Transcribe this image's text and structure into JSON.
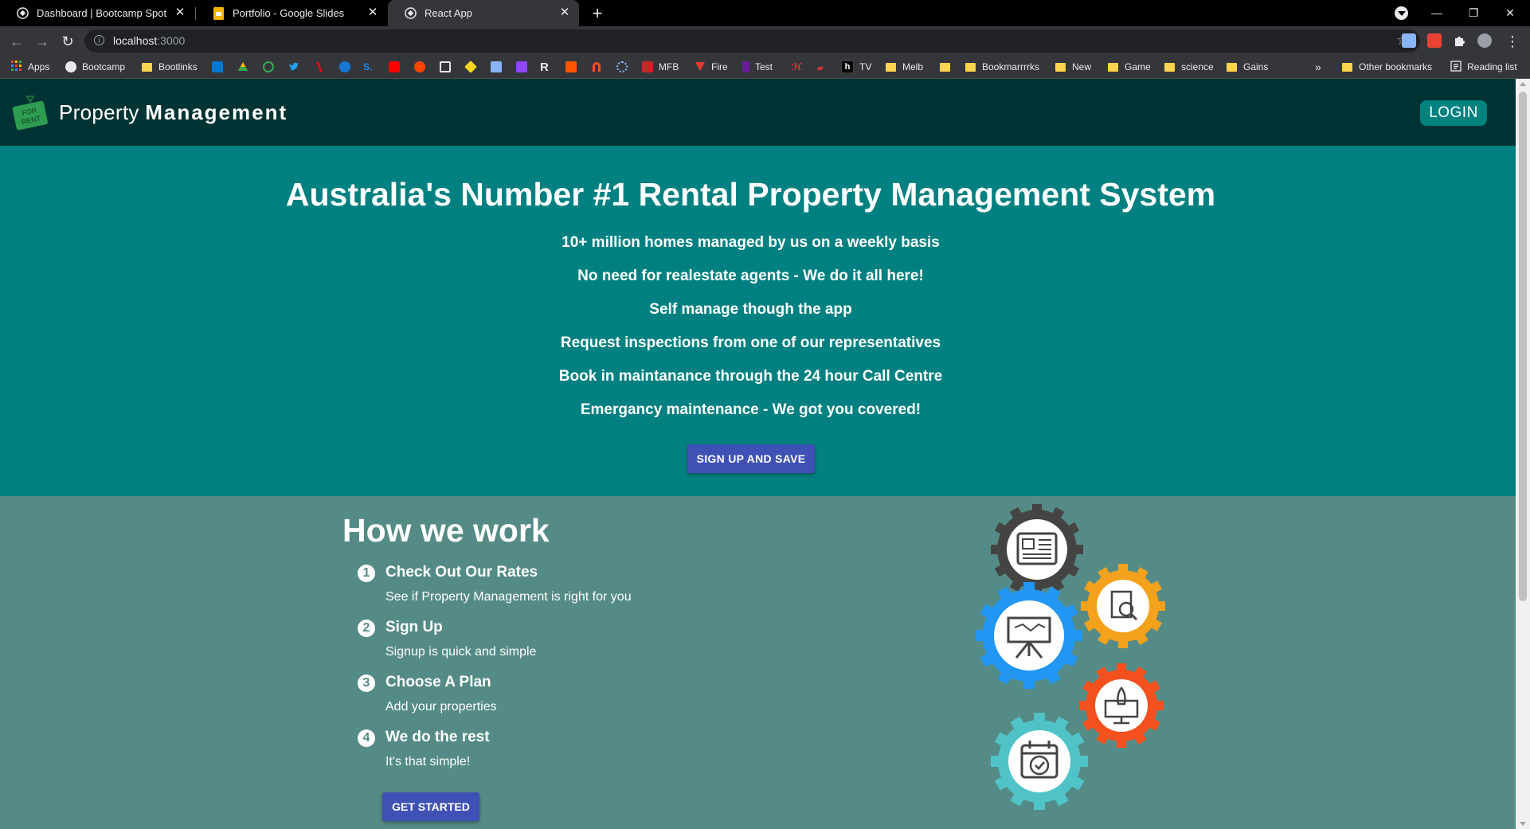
{
  "browser": {
    "tabs": [
      {
        "title": "Dashboard | Bootcamp Spot"
      },
      {
        "title": "Portfolio - Google Slides"
      },
      {
        "title": "React App"
      }
    ],
    "url_host": "localhost",
    "url_port": ":3000",
    "bookmarks": [
      {
        "label": "Apps"
      },
      {
        "label": "Bootcamp"
      },
      {
        "label": "Bootlinks"
      },
      {
        "label": "MFB"
      },
      {
        "label": "Fire"
      },
      {
        "label": "Test"
      },
      {
        "label": "TV"
      },
      {
        "label": "Melb"
      },
      {
        "label": "Bookmarrrrks"
      },
      {
        "label": "New"
      },
      {
        "label": "Game"
      },
      {
        "label": "science"
      },
      {
        "label": "Gains"
      }
    ],
    "overflow": "»",
    "other_bookmarks": "Other bookmarks",
    "reading_list": "Reading list"
  },
  "app": {
    "brand_light": "Property",
    "brand_bold": "Management",
    "login_label": "LOGIN",
    "logo_text": "FOR RENT"
  },
  "hero": {
    "title": "Australia's Number #1 Rental Property Management System",
    "features": [
      "10+ million homes managed by us on a weekly basis",
      "No need for realestate agents - We do it all here!",
      "Self manage though the app",
      "Request inspections from one of our representatives",
      "Book in maintanance through the 24 hour Call Centre",
      "Emergancy maintenance - We got you covered!"
    ],
    "signup_label": "SIGN UP AND SAVE"
  },
  "how": {
    "title": "How we work",
    "steps": [
      {
        "num": "1",
        "title": "Check Out Our Rates",
        "desc": "See if Property Management is right for you"
      },
      {
        "num": "2",
        "title": "Sign Up",
        "desc": "Signup is quick and simple"
      },
      {
        "num": "3",
        "title": "Choose A Plan",
        "desc": "Add your properties"
      },
      {
        "num": "4",
        "title": "We do the rest",
        "desc": "It's that simple!"
      }
    ],
    "cta_label": "GET STARTED"
  },
  "colors": {
    "appbar": "#003333",
    "hero": "#008080",
    "how": "#558b86",
    "button": "#3f51b5",
    "login": "#00827f"
  },
  "icons": [
    "newspaper-icon",
    "document-search-icon",
    "presentation-board-icon",
    "rocket-monitor-icon",
    "calendar-check-icon"
  ]
}
